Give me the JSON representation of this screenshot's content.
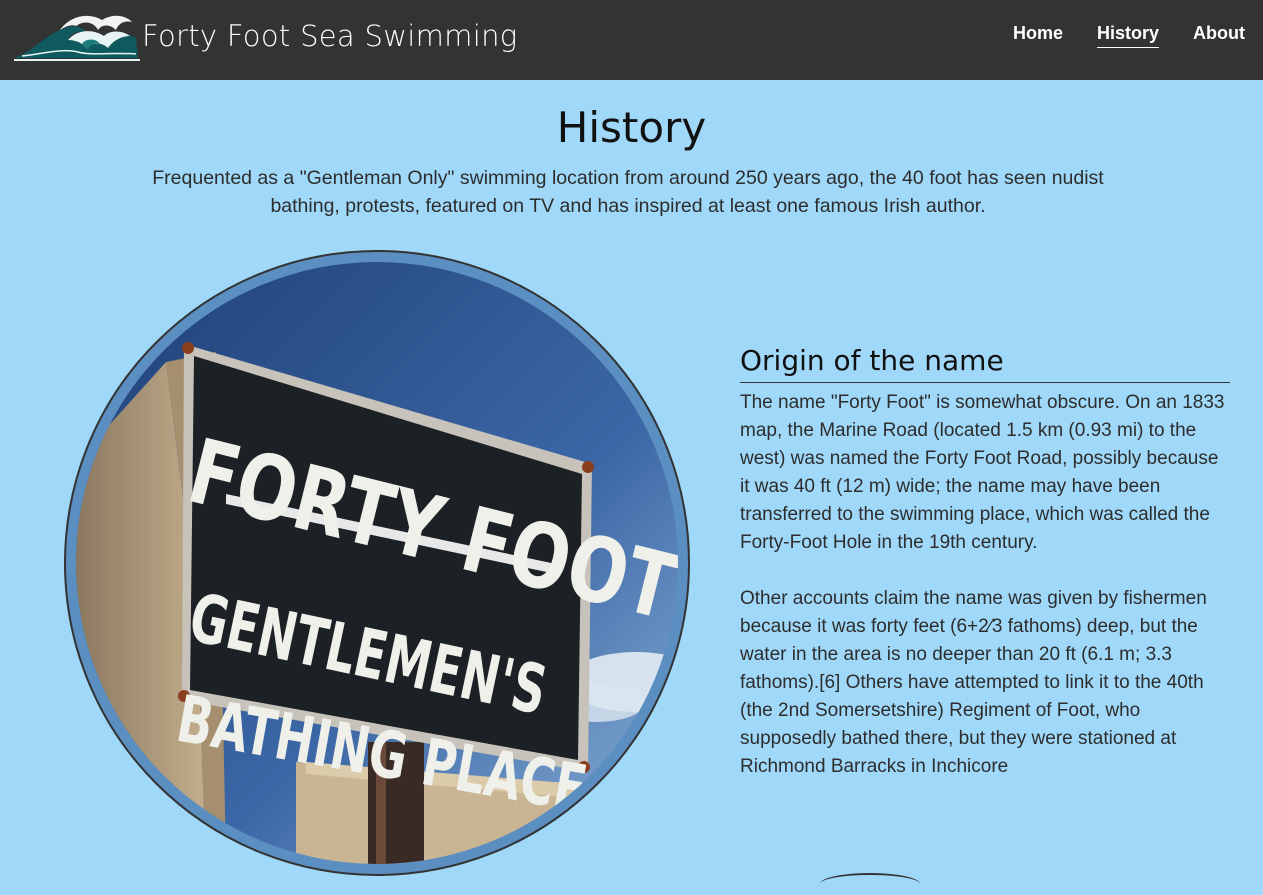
{
  "navbar": {
    "brand_name": "Forty Foot Sea Swimming",
    "logo_icon": "wave-logo-icon",
    "links": [
      {
        "label": "Home",
        "active": false
      },
      {
        "label": "History",
        "active": true
      },
      {
        "label": "About",
        "active": false
      }
    ]
  },
  "page": {
    "title": "History",
    "intro": "Frequented as a \"Gentleman Only\" swimming location from around 250 years ago, the 40 foot has seen nudist bathing, protests, featured on TV and has inspired at least one famous Irish author."
  },
  "image": {
    "sign_line_1": "FORTY FOOT",
    "sign_line_2": "GENTLEMEN'S",
    "sign_line_3": "BATHING PLACE"
  },
  "origin_section": {
    "heading": "Origin of the name",
    "paragraph_1": "The name \"Forty Foot\" is somewhat obscure. On an 1833 map, the Marine Road (located 1.5 km (0.93 mi) to the west) was named the Forty Foot Road, possibly because it was 40 ft (12 m) wide; the name may have been transferred to the swimming place, which was called the Forty-Foot Hole in the 19th century.",
    "paragraph_2": "Other accounts claim the name was given by fishermen because it was forty feet (6+2⁄3 fathoms) deep, but the water in the area is no deeper than 20 ft (6.1 m; 3.3 fathoms).[6] Others have attempted to link it to the 40th (the 2nd Somersetshire) Regiment of Foot, who supposedly bathed there, but they were stationed at Richmond Barracks in Inchicore"
  },
  "colors": {
    "navbar_bg": "#333333",
    "page_bg": "#9fd8f8",
    "circle_border": "#5b8ec1",
    "sign_bg": "#1c2126"
  }
}
